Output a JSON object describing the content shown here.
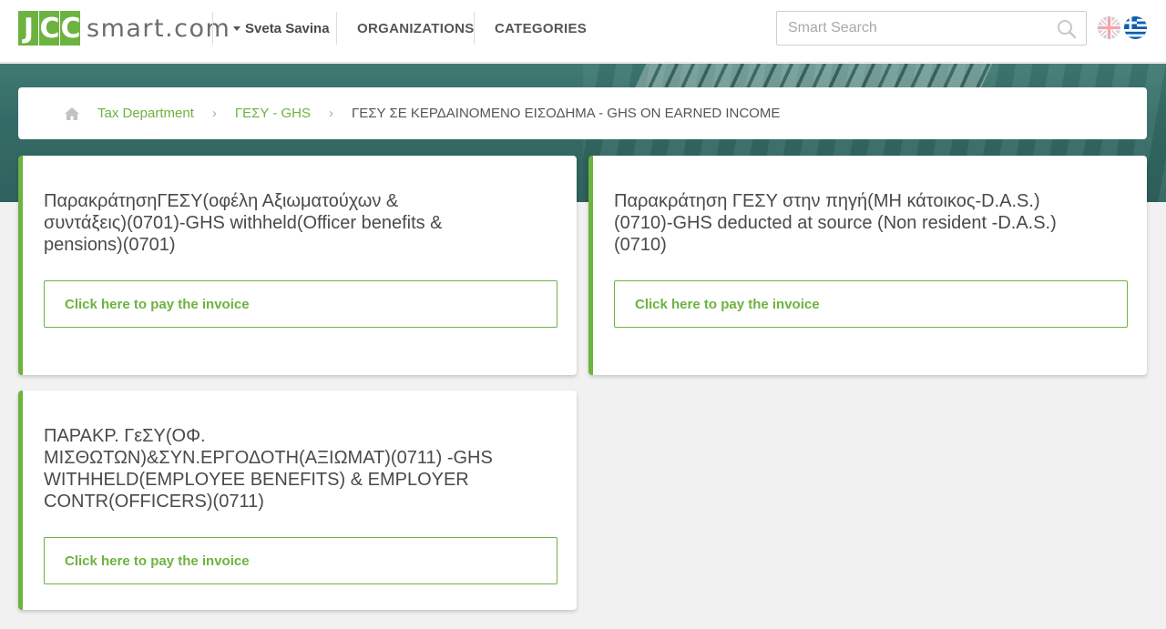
{
  "header": {
    "logo_letters": [
      "J",
      "C",
      "C"
    ],
    "logo_text": "smart.com",
    "user_name": "Sveta Savina",
    "nav": [
      "ORGANIZATIONS",
      "CATEGORIES"
    ],
    "search_placeholder": "Smart Search",
    "languages": [
      "English",
      "Greek"
    ]
  },
  "breadcrumb": {
    "items": [
      "Tax Department",
      "ΓΕΣΥ - GHS"
    ],
    "current": "ΓΕΣΥ ΣΕ ΚΕΡΔΑΙΝΟΜΕΝΟ ΕΙΣΟΔΗΜΑ - GHS ON EARNED INCOME"
  },
  "cards": [
    {
      "title_lines": [
        "ΠαρακράτησηΓΕΣΥ(οφέλη Αξιωματούχων &",
        "συντάξεις)(0701)-GHS withheld(Officer benefits &",
        "pensions)(0701)"
      ],
      "button": "Click here to pay the invoice"
    },
    {
      "title_lines": [
        "Παρακράτηση ΓΕΣΥ στην πηγή(ΜΗ κάτοικος-D.A.S.)",
        "(0710)-GHS deducted at source (Non resident -D.A.S.)",
        "(0710)"
      ],
      "button": "Click here to pay the invoice"
    },
    {
      "title_lines": [
        "ΠΑΡΑΚΡ. ΓεΣΥ(ΟΦ.",
        "ΜΙΣΘΩΤΩΝ)&ΣΥΝ.ΕΡΓΟΔΟΤΗ(ΑΞΙΩΜΑΤ)(0711) -GHS",
        "WITHHELD(EMPLOYEE BENEFITS) & EMPLOYER",
        "CONTR(OFFICERS)(0711)"
      ],
      "button": "Click here to pay the invoice"
    }
  ],
  "colors": {
    "accent": "#6cb33f",
    "banner": "#356b66",
    "background": "#f1f1f1"
  },
  "icons": [
    "home-icon",
    "search-icon",
    "caret-down-icon",
    "uk-flag-icon",
    "greek-flag-icon"
  ]
}
